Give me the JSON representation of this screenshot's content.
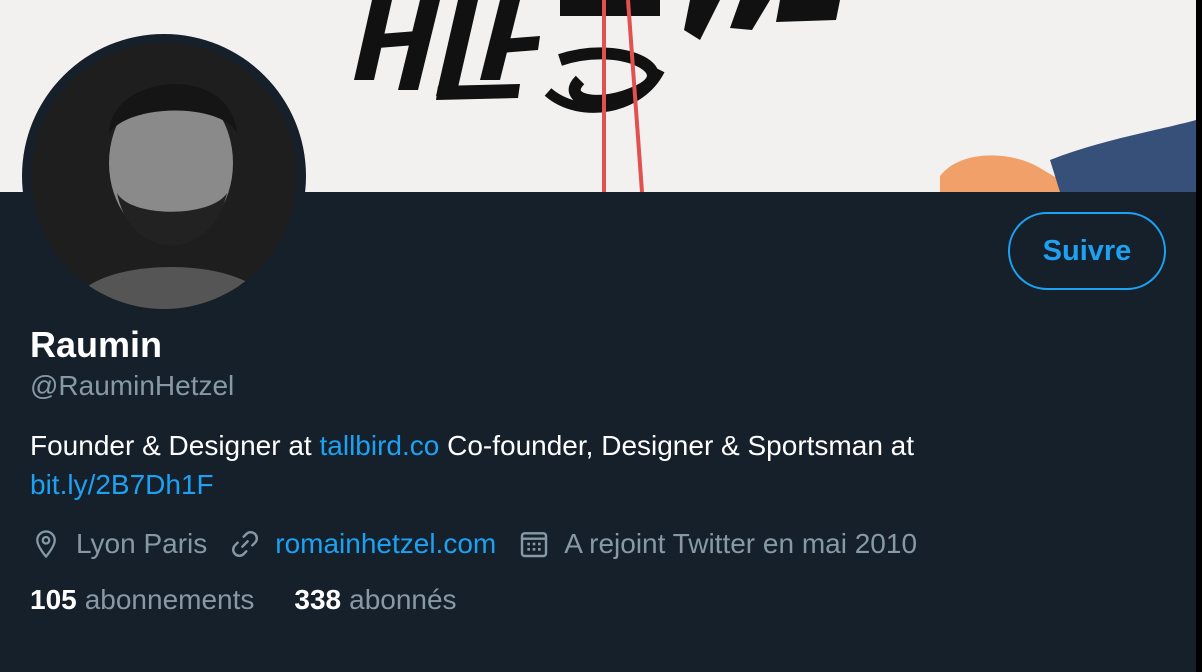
{
  "profile": {
    "display_name": "Raumin",
    "handle": "@RauminHetzel",
    "bio_text_1": "Founder & Designer at ",
    "bio_link_1": "tallbird.co",
    "bio_text_2": " Co-founder, Designer & Sportsman at",
    "bio_link_2": "bit.ly/2B7Dh1F",
    "location": "Lyon Paris",
    "website": "romainhetzel.com",
    "joined": "A rejoint Twitter en mai 2010"
  },
  "actions": {
    "follow_label": "Suivre"
  },
  "stats": {
    "following_count": "105",
    "following_label": "abonnements",
    "followers_count": "338",
    "followers_label": "abonnés"
  },
  "colors": {
    "background": "#15202b",
    "accent": "#1da1f2",
    "secondary_text": "#8899a6",
    "banner": "#f2f1ef"
  },
  "icons": [
    "location-pin-icon",
    "link-icon",
    "calendar-icon"
  ]
}
